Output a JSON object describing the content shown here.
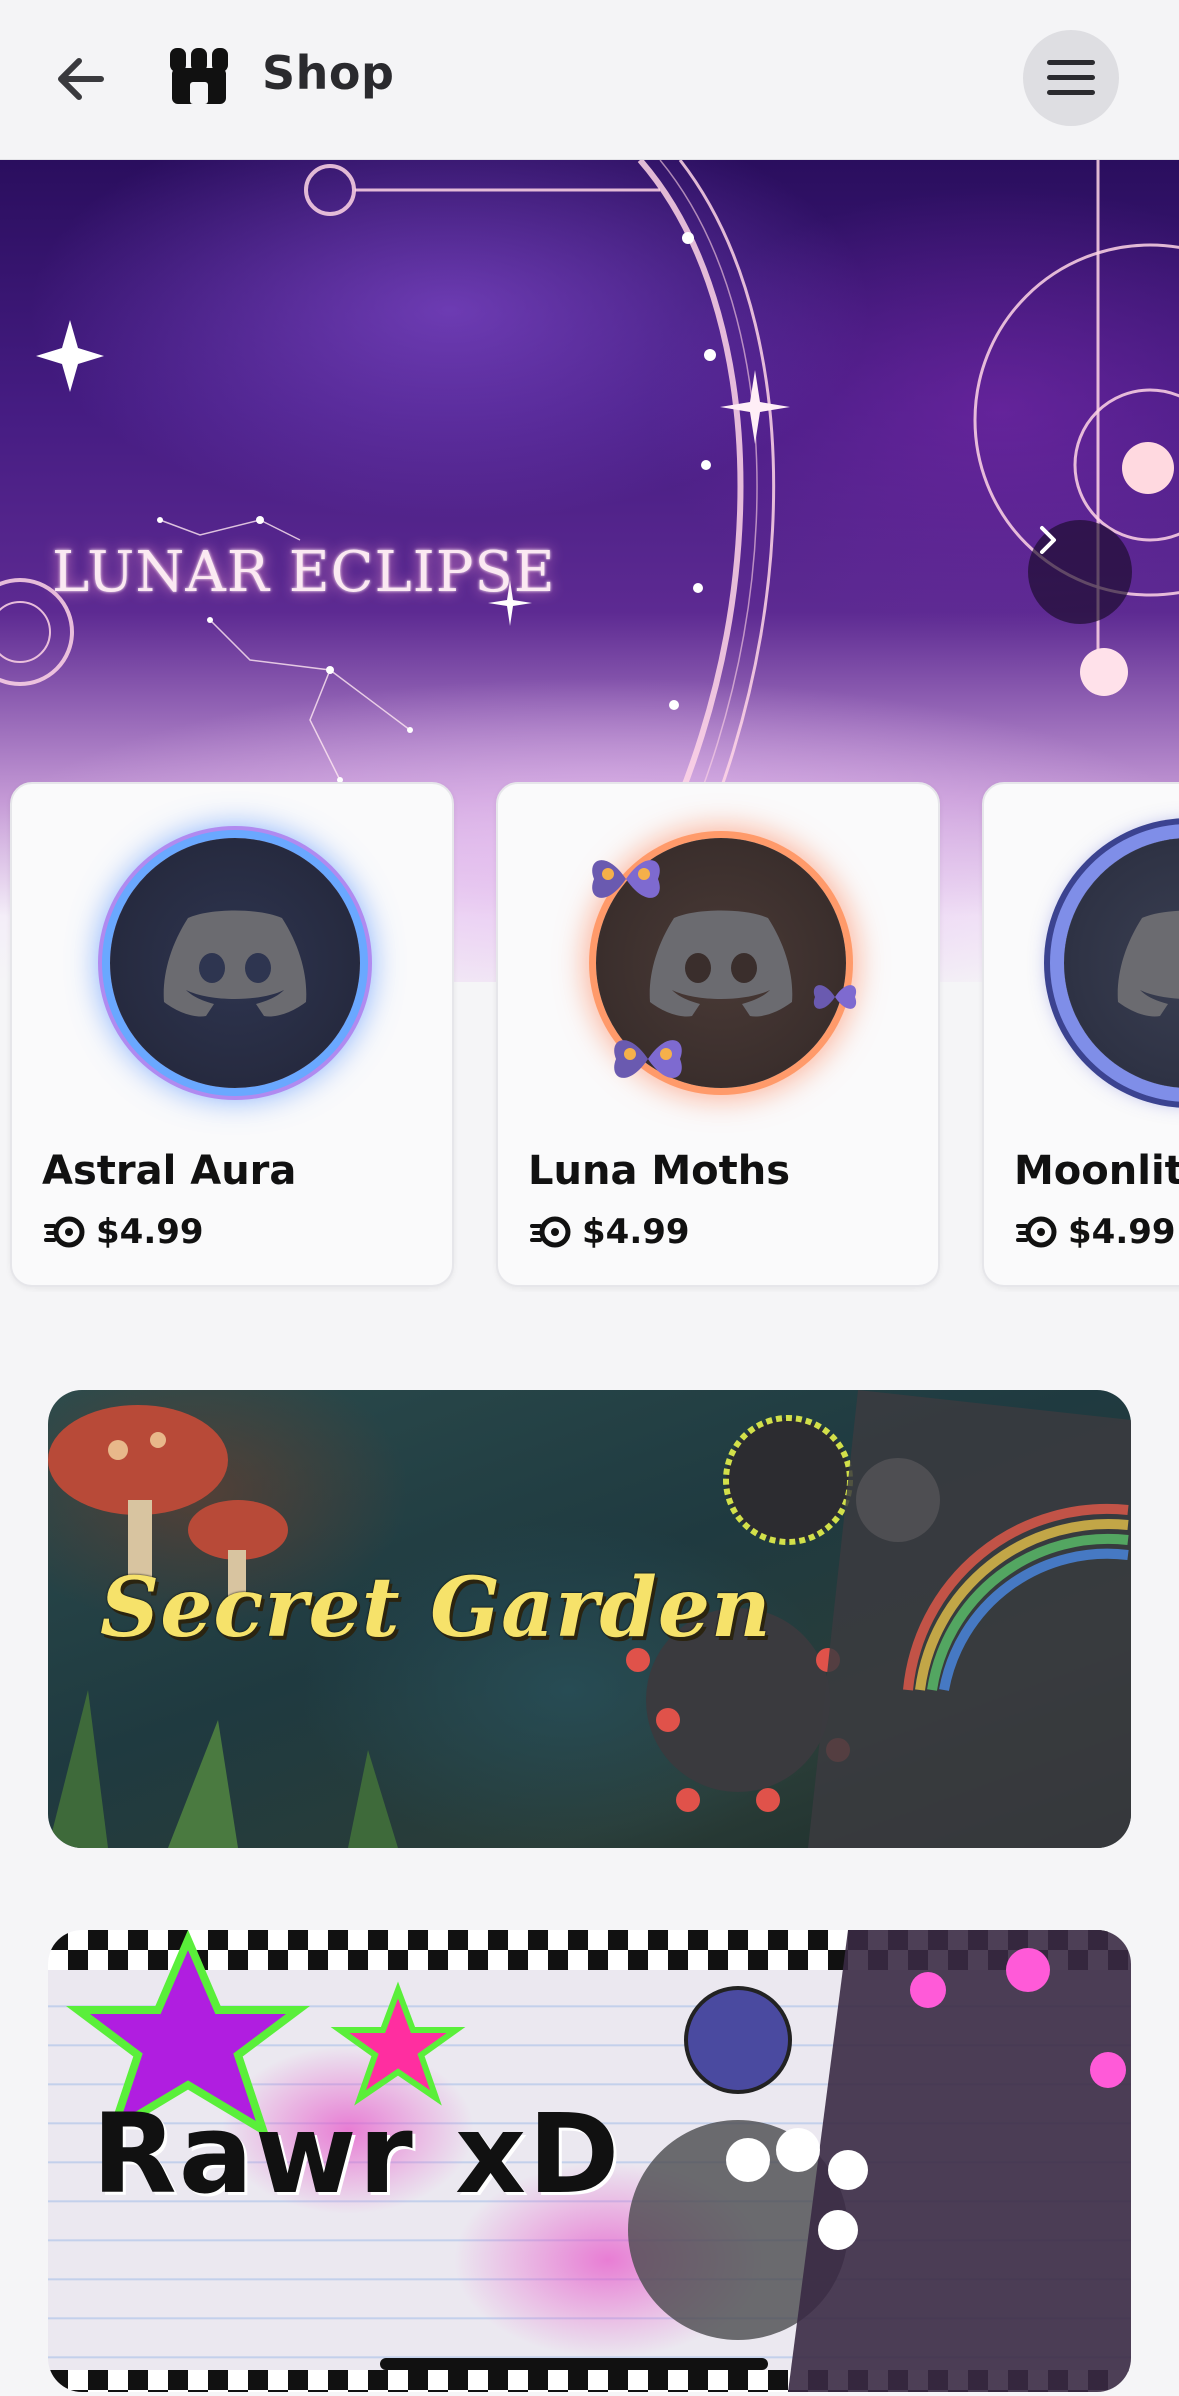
{
  "header": {
    "title": "Shop",
    "back_icon": "arrow-left-icon",
    "shop_icon": "shop-storefront-icon",
    "menu_icon": "hamburger-menu-icon"
  },
  "hero": {
    "title": "LUNAR ECLIPSE",
    "next_icon": "chevron-right-icon"
  },
  "cards": [
    {
      "name": "Astral Aura",
      "price": "$4.99",
      "ring_color": "#6aa8ff"
    },
    {
      "name": "Luna Moths",
      "price": "$4.99",
      "ring_color": "#ff9a6a"
    },
    {
      "name": "Moonlit C",
      "price": "$4.99",
      "ring_color": "#7f8ee8"
    }
  ],
  "banners": [
    {
      "title": "Secret Garden"
    },
    {
      "title": "Rawr xD"
    }
  ],
  "colors": {
    "accent": "#5d2a92",
    "background": "#f5f5f7"
  }
}
